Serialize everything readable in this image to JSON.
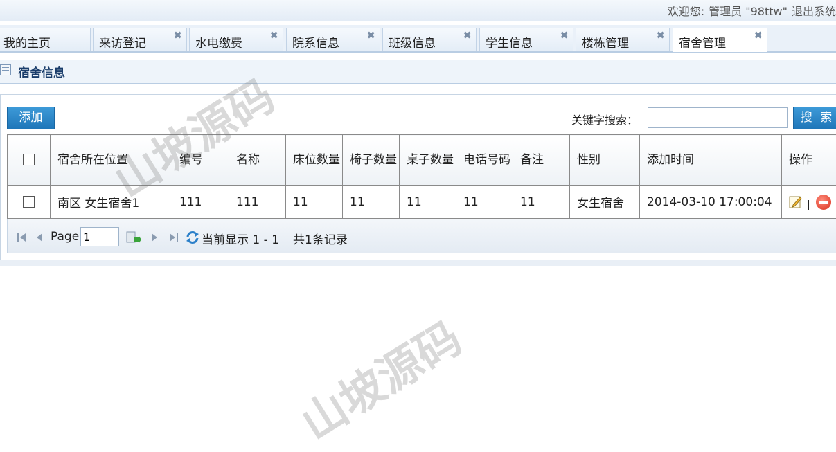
{
  "header": {
    "welcome_prefix": "欢迎您:",
    "user": "管理员 \"98ttw\"",
    "logout": "退出系统"
  },
  "tabs": [
    {
      "label": "我的主页",
      "closable": false
    },
    {
      "label": "来访登记",
      "closable": true
    },
    {
      "label": "水电缴费",
      "closable": true
    },
    {
      "label": "院系信息",
      "closable": true
    },
    {
      "label": "班级信息",
      "closable": true
    },
    {
      "label": "学生信息",
      "closable": true
    },
    {
      "label": "楼栋管理",
      "closable": true
    },
    {
      "label": "宿舍管理",
      "closable": true,
      "active": true
    }
  ],
  "tab_close_glyph": "✖",
  "panel": {
    "title": "宿舍信息",
    "icon": "table-icon"
  },
  "toolbar": {
    "add_label": "添加",
    "search_label": "关键字搜索：",
    "search_value": "",
    "search_button": "搜 索"
  },
  "table": {
    "columns": [
      "宿舍所在位置",
      "编号",
      "名称",
      "床位数量",
      "椅子数量",
      "桌子数量",
      "电话号码",
      "备注",
      "性别",
      "添加时间",
      "操作"
    ],
    "rows": [
      [
        "南区 女生宿舍1",
        "111",
        "111",
        "11",
        "11",
        "11",
        "11",
        "11",
        "女生宿舍",
        "2014-03-10 17:00:04"
      ]
    ]
  },
  "pager": {
    "page_label": "Page",
    "page_value": "1",
    "info": "当前显示 1 - 1",
    "total": "共1条记录"
  },
  "watermark": "山坡源码",
  "colors": {
    "accent": "#2a86c8",
    "header_text": "#1a3d6b",
    "delete": "#d8301c"
  }
}
